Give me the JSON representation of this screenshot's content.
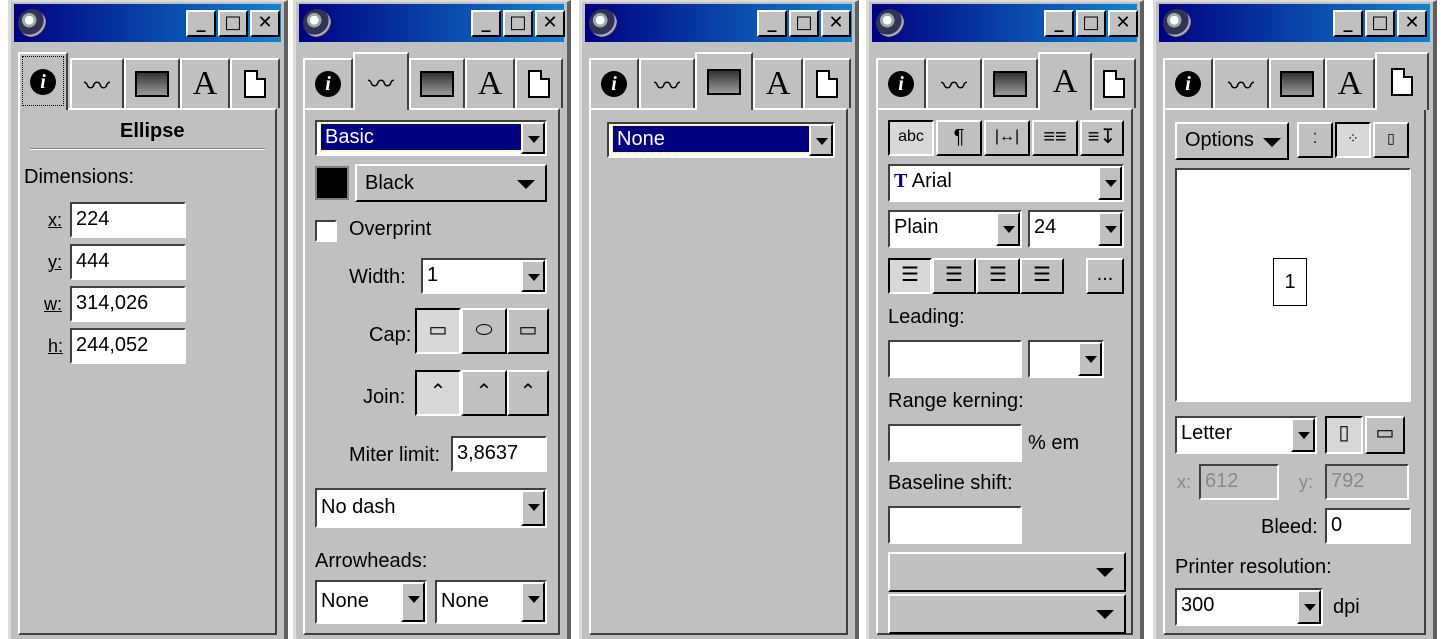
{
  "panel1": {
    "heading": "Ellipse",
    "dimensions_label": "Dimensions:",
    "x_label": "x:",
    "x_value": "224",
    "y_label": "y:",
    "y_value": "444",
    "w_label": "w:",
    "w_value": "314,026",
    "h_label": "h:",
    "h_value": "244,052"
  },
  "panel2": {
    "stroke_type": "Basic",
    "color_name": "Black",
    "overprint_label": "Overprint",
    "width_label": "Width:",
    "width_value": "1",
    "cap_label": "Cap:",
    "join_label": "Join:",
    "miter_label": "Miter limit:",
    "miter_value": "3,8637",
    "dash_value": "No dash",
    "arrowheads_label": "Arrowheads:",
    "arrow_start": "None",
    "arrow_end": "None"
  },
  "panel3": {
    "fill_type": "None"
  },
  "panel4": {
    "btn_abc": "abc",
    "font_name": "Arial",
    "style_value": "Plain",
    "size_value": "24",
    "more_label": "...",
    "leading_label": "Leading:",
    "kerning_label": "Range kerning:",
    "kerning_unit": "% em",
    "baseline_label": "Baseline shift:"
  },
  "panel5": {
    "options_label": "Options",
    "page_number": "1",
    "paper_size": "Letter",
    "x_label": "x:",
    "x_value": "612",
    "y_label": "y:",
    "y_value": "792",
    "bleed_label": "Bleed:",
    "bleed_value": "0",
    "printer_res_label": "Printer resolution:",
    "res_value": "300",
    "dpi_label": "dpi"
  },
  "colors": {
    "titlebar_start": "#000080",
    "titlebar_end": "#1084d0",
    "face": "#c0c0c0",
    "selection": "#000080"
  }
}
